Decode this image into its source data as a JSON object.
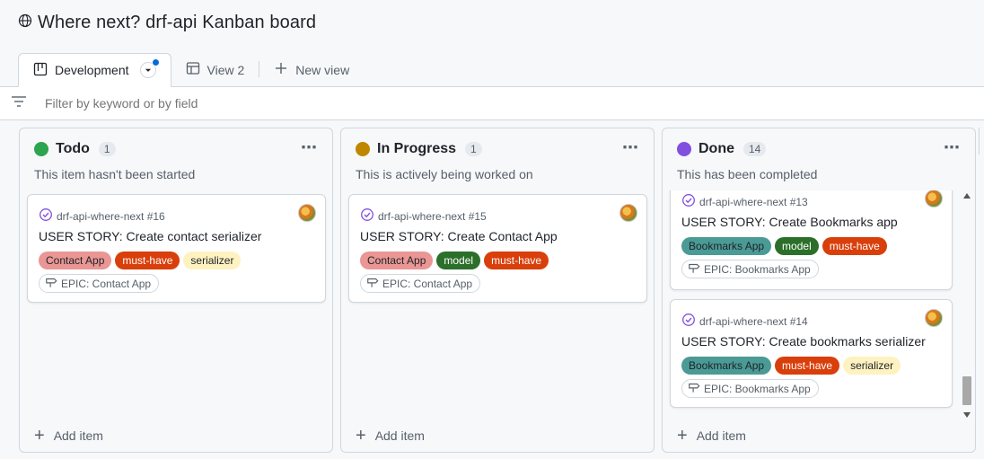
{
  "header": {
    "title": "Where next? drf-api Kanban board",
    "globe_icon": "globe-icon"
  },
  "tabs": [
    {
      "label": "Development",
      "icon": "board-icon",
      "active": true
    },
    {
      "label": "View 2",
      "icon": "table-icon",
      "active": false
    },
    {
      "label": "New view",
      "icon": "plus-icon",
      "active": false
    }
  ],
  "filter": {
    "placeholder": "Filter by keyword or by field"
  },
  "columns": [
    {
      "name": "Todo",
      "count": "1",
      "color": "#2da44e",
      "description": "This item hasn't been started",
      "add_label": "Add item",
      "cards": [
        {
          "repo": "drf-api-where-next #16",
          "title": "USER STORY: Create contact serializer",
          "labels": [
            {
              "text": "Contact App",
              "bg": "#e99695",
              "fg": "#1f2328"
            },
            {
              "text": "must-have",
              "bg": "#d93f0b",
              "fg": "#ffffff"
            },
            {
              "text": "serializer",
              "bg": "#fef2c0",
              "fg": "#1f2328"
            }
          ],
          "epic": "EPIC: Contact App"
        }
      ]
    },
    {
      "name": "In Progress",
      "count": "1",
      "color": "#bf8700",
      "description": "This is actively being worked on",
      "add_label": "Add item",
      "cards": [
        {
          "repo": "drf-api-where-next #15",
          "title": "USER STORY: Create Contact App",
          "labels": [
            {
              "text": "Contact App",
              "bg": "#e99695",
              "fg": "#1f2328"
            },
            {
              "text": "model",
              "bg": "#2b6f2a",
              "fg": "#ffffff"
            },
            {
              "text": "must-have",
              "bg": "#d93f0b",
              "fg": "#ffffff"
            }
          ],
          "epic": "EPIC: Contact App"
        }
      ]
    },
    {
      "name": "Done",
      "count": "14",
      "color": "#8250df",
      "description": "This has been completed",
      "add_label": "Add item",
      "cards": [
        {
          "repo": "drf-api-where-next #13",
          "title": "USER STORY: Create Bookmarks app",
          "labels": [
            {
              "text": "Bookmarks App",
              "bg": "#4a9a95",
              "fg": "#1f2328"
            },
            {
              "text": "model",
              "bg": "#2b6f2a",
              "fg": "#ffffff"
            },
            {
              "text": "must-have",
              "bg": "#d93f0b",
              "fg": "#ffffff"
            }
          ],
          "epic": "EPIC: Bookmarks App"
        },
        {
          "repo": "drf-api-where-next #14",
          "title": "USER STORY: Create bookmarks serializer",
          "labels": [
            {
              "text": "Bookmarks App",
              "bg": "#4a9a95",
              "fg": "#1f2328"
            },
            {
              "text": "must-have",
              "bg": "#d93f0b",
              "fg": "#ffffff"
            },
            {
              "text": "serializer",
              "bg": "#fef2c0",
              "fg": "#1f2328"
            }
          ],
          "epic": "EPIC: Bookmarks App"
        }
      ]
    }
  ]
}
